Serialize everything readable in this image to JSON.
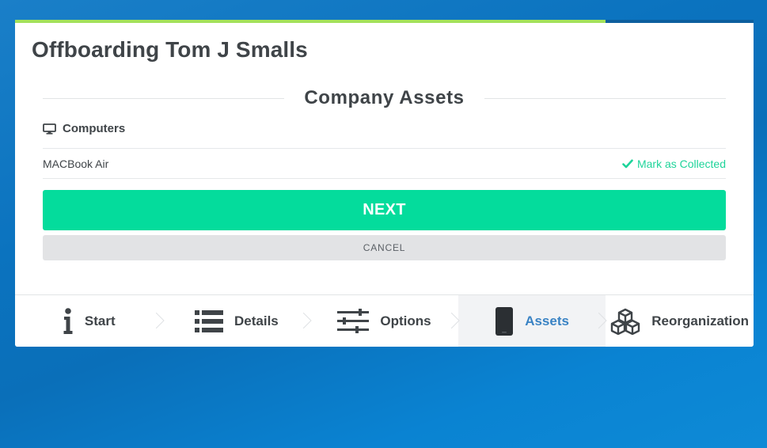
{
  "wizard": {
    "progress": 0.8
  },
  "page": {
    "title": "Offboarding Tom J Smalls"
  },
  "section": {
    "heading": "Company Assets",
    "category_label": "Computers",
    "category_icon": "monitor-icon"
  },
  "assets": [
    {
      "name": "MACBook Air",
      "action_label": "Mark as Collected",
      "action_icon": "checkmark-icon"
    }
  ],
  "buttons": {
    "next_label": "NEXT",
    "cancel_label": "CANCEL"
  },
  "tabs": [
    {
      "label": "Start",
      "icon": "info-icon",
      "active": false
    },
    {
      "label": "Details",
      "icon": "list-icon",
      "active": false
    },
    {
      "label": "Options",
      "icon": "sliders-icon",
      "active": false
    },
    {
      "label": "Assets",
      "icon": "phone-icon",
      "active": true
    },
    {
      "label": "Reorganization",
      "icon": "cubes-icon",
      "active": false
    }
  ],
  "colors": {
    "accent_green": "#04dc9c",
    "link_green": "#1ed49a",
    "active_tab_blue": "#3a83c4",
    "progress_lime": "#a3e15b"
  }
}
